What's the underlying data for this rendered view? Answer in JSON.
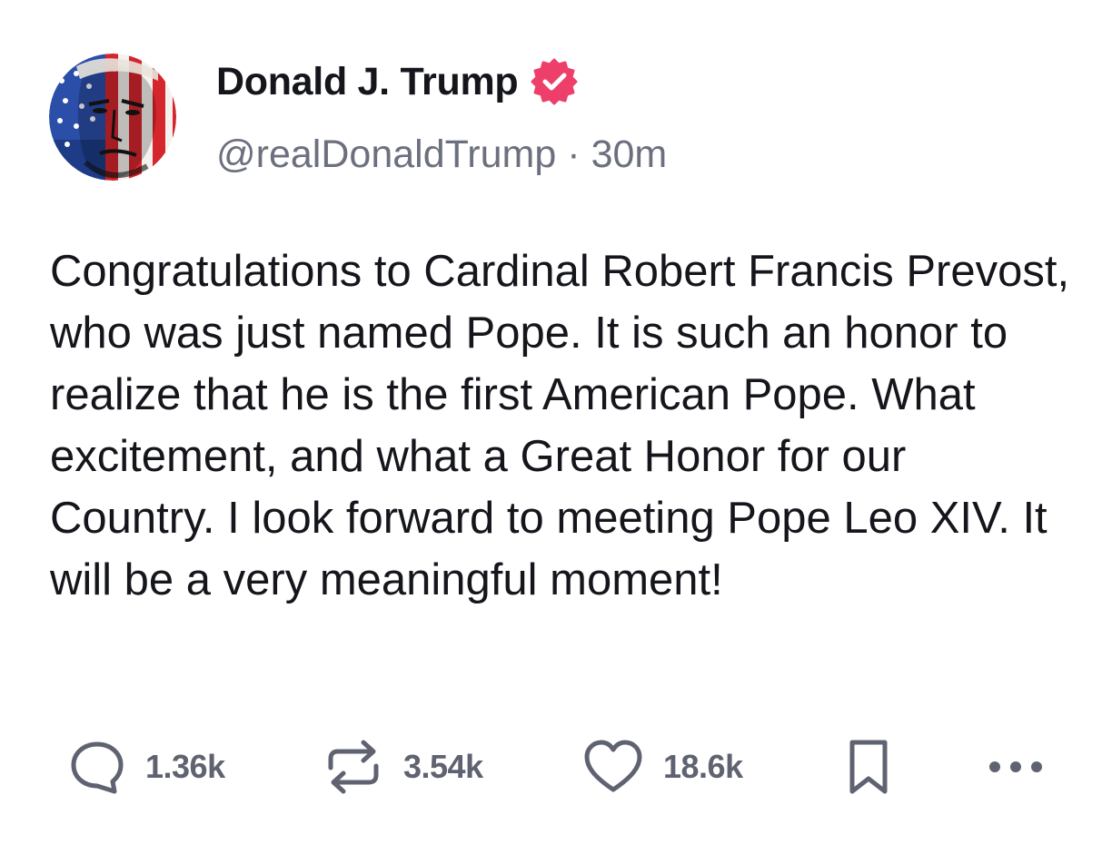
{
  "author": {
    "display_name": "Donald J. Trump",
    "handle": "@realDonaldTrump",
    "separator": "·",
    "time_ago": "30m",
    "verified_badge_color": "#ee3f6a",
    "avatar_icon": "avatar-flag-portrait"
  },
  "post": {
    "text": "Congratulations to Cardinal Robert Francis Prevost, who was just named Pope. It is such an honor to realize that he is the first American Pope. What excitement, and what a Great Honor for our Country. I look forward to meeting Pope Leo XIV. It will be a very meaningful moment!"
  },
  "actions": {
    "reply": {
      "icon": "reply-icon",
      "count": "1.36k"
    },
    "repost": {
      "icon": "repost-icon",
      "count": "3.54k"
    },
    "like": {
      "icon": "heart-icon",
      "count": "18.6k"
    },
    "save": {
      "icon": "bookmark-icon"
    },
    "more": {
      "icon": "more-icon"
    }
  },
  "colors": {
    "text": "#15161c",
    "muted": "#6c6f7e",
    "icon": "#5f6270",
    "background": "#ffffff"
  }
}
